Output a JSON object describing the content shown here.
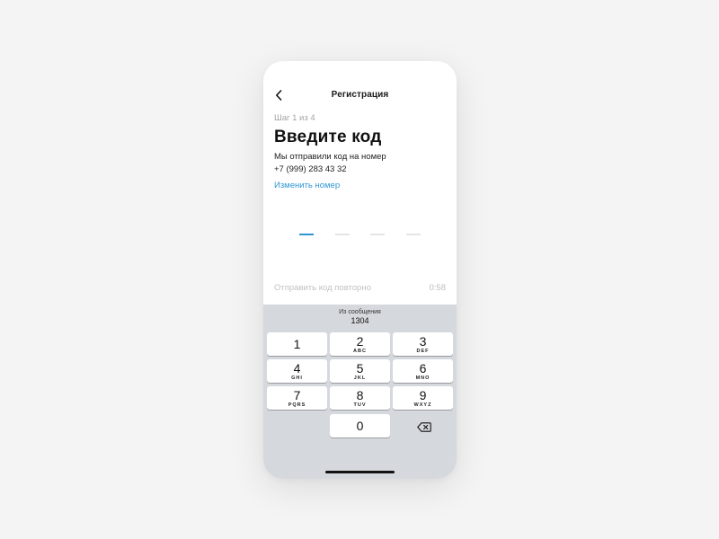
{
  "nav": {
    "title": "Регистрация",
    "back_icon": "chevron-left-icon"
  },
  "content": {
    "step": "Шаг 1 из 4",
    "heading": "Введите код",
    "subtitle_line1": "Мы отправили код на номер",
    "phone_number": "+7 (999) 283 43 32",
    "change_number": "Изменить номер",
    "code_length": 4,
    "active_slot": 1,
    "resend": "Отправить код повторно",
    "timer": "0:58"
  },
  "colors": {
    "accent": "#2f96d4",
    "keyboard_bg": "#d5d8dd",
    "muted_text": "#c2c2c2"
  },
  "keyboard": {
    "suggestion_label": "Из сообщения",
    "suggestion_code": "1304",
    "keys": [
      {
        "num": "1",
        "letters": ""
      },
      {
        "num": "2",
        "letters": "ABC"
      },
      {
        "num": "3",
        "letters": "DEF"
      },
      {
        "num": "4",
        "letters": "GHI"
      },
      {
        "num": "5",
        "letters": "JKL"
      },
      {
        "num": "6",
        "letters": "MNO"
      },
      {
        "num": "7",
        "letters": "PQRS"
      },
      {
        "num": "8",
        "letters": "TUV"
      },
      {
        "num": "9",
        "letters": "WXYZ"
      },
      {
        "num": "0",
        "letters": ""
      }
    ],
    "backspace_icon": "backspace-icon"
  }
}
